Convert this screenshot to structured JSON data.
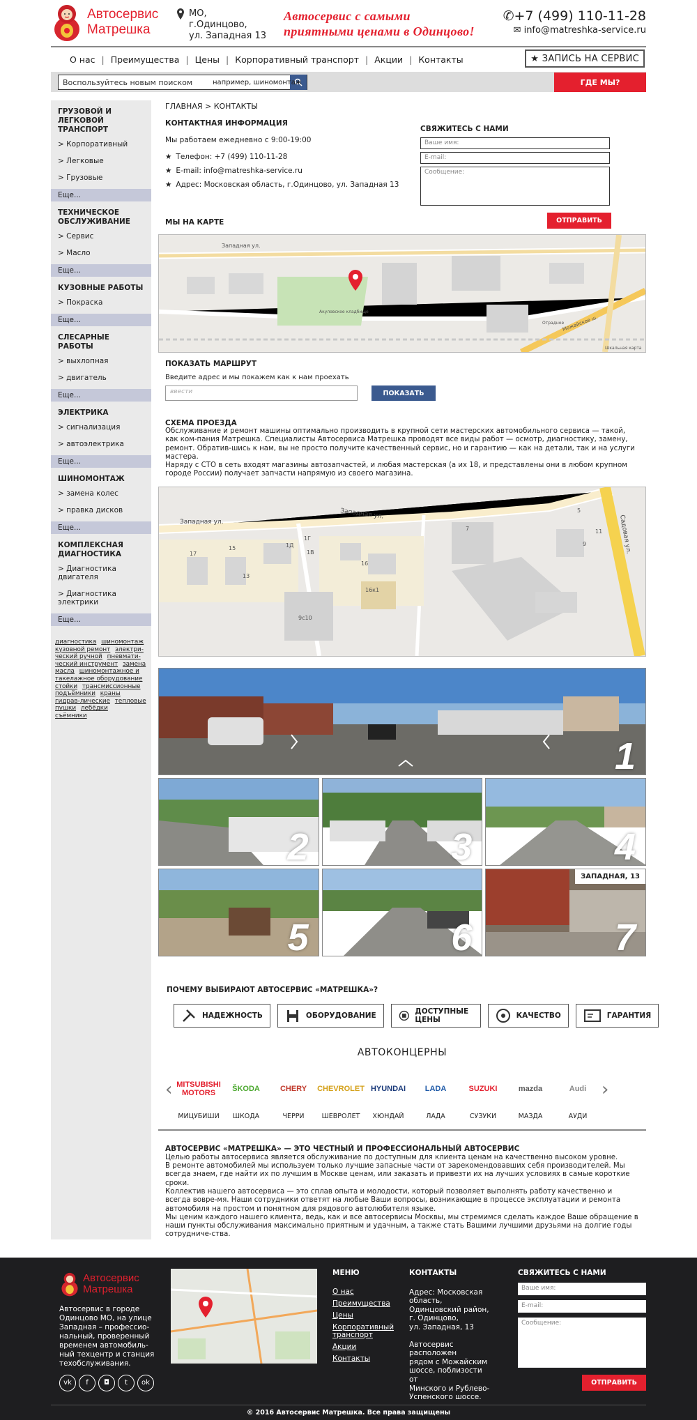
{
  "header": {
    "logo_line1": "Автосервис",
    "logo_line2": "Матрешка",
    "address": [
      "МО,",
      "г.Одинцово,",
      "ул. Западная 13"
    ],
    "slogan_line1": "Автосервис с самыми",
    "slogan_line2": "приятными ценами в Одинцово!",
    "phone": "+7 (499) 110-11-28",
    "email": "info@matreshka-service.ru"
  },
  "nav": [
    "О нас",
    "Преимущества",
    "Цены",
    "Корпоративный транспорт",
    "Акции",
    "Контакты"
  ],
  "appointment_label": "ЗАПИСЬ НА СЕРВИС",
  "search": {
    "value": "Воспользуйтесь новым поиском",
    "hint": "например, шиномонтаж"
  },
  "where_label": "ГДЕ МЫ?",
  "sidebar": [
    {
      "title": "Грузовой и легковой транспорт",
      "items": [
        "> Корпоративный",
        "> Легковые",
        "> Грузовые"
      ]
    },
    {
      "title": "Техническое обслуживание",
      "items": [
        "> Сервис",
        "> Масло"
      ]
    },
    {
      "title": "Кузовные работы",
      "items": [
        "> Покраска"
      ]
    },
    {
      "title": "Слесарные работы",
      "items": [
        "> выхлопная",
        "> двигатель"
      ]
    },
    {
      "title": "Электрика",
      "items": [
        "> сигнализация",
        "> автоэлектрика"
      ]
    },
    {
      "title": "Шиномонтаж",
      "items": [
        "> замена колес",
        "> правка дисков"
      ]
    },
    {
      "title": "Комплексная диагностика",
      "items": [
        "> Диагностика двигателя",
        "> Диагностика электрики"
      ]
    }
  ],
  "more_label": "Еще...",
  "tags": [
    "диагностика",
    "шиномонтаж",
    "кузовной ремонт",
    "электри-ческий ручной",
    "пневмати-ческий инструмент",
    "замена масла",
    "шиномонтажное и такелажное оборудование",
    "стойки",
    "трансмиссионные подъёмники",
    "краны гидрав-лические",
    "тепловые пушки",
    "лебёдки",
    "съёмники"
  ],
  "breadcrumb": "ГЛАВНАЯ > КОНТАКТЫ",
  "contact": {
    "title": "КОНТАКТНАЯ ИНФОРМАЦИЯ",
    "hours": "Мы работаем ежедневно с 9:00-19:00",
    "lines": [
      "Телефон: +7 (499) 110-11-28",
      "E-mail: info@matreshka-service.ru",
      "Адрес: Московская область, г.Одинцово, ул. Западная 13"
    ]
  },
  "form": {
    "title": "СВЯЖИТЕСЬ С НАМИ",
    "name_ph": "Ваше имя:",
    "email_ph": "E-mail:",
    "msg_ph": "Сообщение:",
    "send": "ОТПРАВИТЬ"
  },
  "map_title": "МЫ НА КАРТЕ",
  "map1_labels": {
    "street": "Западная ул.",
    "cemetery": "Акуловское кладбище",
    "highway": "Можайское ш.",
    "station": "Отрадное",
    "footer": "Шкальная карта"
  },
  "route": {
    "title": "ПОКАЗАТЬ МАРШРУТ",
    "hint": "Введите адрес и мы покажем как к нам проехать",
    "input_ph": "ввести",
    "button": "ПОКАЗАТЬ"
  },
  "scheme": {
    "title": "СХЕМА ПРОЕЗДА",
    "text1": "Обслуживание и ремонт машины оптимально производить в крупной сети мастерских автомобильного сервиса — такой, как ком-пания Матрешка. Специалисты Автосервиса Матрешка проводят все виды работ — осмотр, диагностику, замену, ремонт. Обратив-шись к нам, вы не просто получите качественный сервис, но и гарантию — как на детали, так и на услуги мастера.",
    "text2": "Наряду с СТО в сеть входят магазины автозапчастей, и любая мастерская (а их 18, и представлены они в любом крупном городе России) получает запчасти напрямую из своего магазина."
  },
  "map2_labels": {
    "street1": "Западная ул.",
    "street2": "Западная ул.",
    "street3": "Садовая ул.",
    "b1": "17",
    "b2": "15",
    "b3": "13",
    "b4": "1Д",
    "b5": "1Г",
    "b6": "1В",
    "b7": "9с10",
    "b8": "16",
    "b9": "16к1",
    "b10": "7",
    "b11": "9",
    "b12": "11",
    "b13": "5"
  },
  "photos": {
    "n1": "1",
    "n2": "2",
    "n3": "3",
    "n4": "4",
    "n5": "5",
    "n6": "6",
    "n7": "7",
    "tag": "ЗАПАДНАЯ, 13",
    "street": "Западная"
  },
  "why": {
    "title": "ПОЧЕМУ ВЫБИРАЮТ АВТОСЕРВИС «МАТРЕШКА»?",
    "buttons": [
      "НАДЕЖНОСТЬ",
      "ОБОРУДОВАНИЕ",
      "ДОСТУПНЫЕ ЦЕНЫ",
      "КАЧЕСТВО",
      "ГАРАНТИЯ"
    ]
  },
  "brands_title": "АВТОКОНЦЕРНЫ",
  "brands": [
    {
      "name": "МИЦУБИШИ",
      "logo": "MITSUBISHI MOTORS"
    },
    {
      "name": "ШКОДА",
      "logo": "ŠKODA"
    },
    {
      "name": "ЧЕРРИ",
      "logo": "CHERY"
    },
    {
      "name": "ШЕВРОЛЕТ",
      "logo": "CHEVROLET"
    },
    {
      "name": "ХЮНДАЙ",
      "logo": "HYUNDAI"
    },
    {
      "name": "ЛАДА",
      "logo": "LADA"
    },
    {
      "name": "СУЗУКИ",
      "logo": "SUZUKI"
    },
    {
      "name": "МАЗДА",
      "logo": "mazda"
    },
    {
      "name": "АУДИ",
      "logo": "Audi"
    }
  ],
  "about": {
    "title": "АВТОСЕРВИС «МАТРЕШКА» — ЭТО ЧЕСТНЫЙ И ПРОФЕССИОНАЛЬНЫЙ АВТОСЕРВИС",
    "p1": "Целью работы автосервиса является обслуживание по доступным для клиента ценам на качественно высоком уровне.",
    "p2": "В ремонте автомобилей мы используем только лучшие запасные части от зарекомендовавших себя производителей. Мы всегда знаем, где найти их по лучшим в Москве ценам, или заказать и привезти их на лучших условиях в самые короткие сроки.",
    "p3": "Коллектив нашего автосервиса — это сплав опыта и молодости, который позволяет выполнять работу качественно и всегда вовре-мя. Наши сотрудники ответят на любые Ваши вопросы, возникающие в процессе эксплуатации и ремонта автомобиля на простом и понятном для рядового автолюбителя языке.",
    "p4": "Мы ценим каждого нашего клиента, ведь, как и все автосервисы Москвы, мы стремимся сделать каждое Ваше обращение в наши пункты обслуживания максимально приятным и удачным, а также стать Вашими лучшими друзьями на долгие годы сотрудниче-ства."
  },
  "footer": {
    "desc": "Автосервис в городе Одинцово МО, на улице Западная – профессио-нальный, проверенный временем автомобиль-ный техцентр и станция техобслуживания.",
    "menu_title": "МЕНЮ",
    "menu": [
      "О нас",
      "Преимущества",
      "Цены",
      "Корпоративный транспорт",
      "Акции",
      "Контакты"
    ],
    "contacts_title": "КОНТАКТЫ",
    "contacts_addr": [
      "Адрес: Московская",
      "область,",
      "Одинцовский район,",
      "г. Одинцово,",
      "ул. Западная, 13"
    ],
    "contacts_note": [
      "Автосервис расположен",
      "рядом с Можайским",
      "шоссе, поблизости от",
      "Минского и Рублево-",
      "Успенского шоссе."
    ],
    "form_title": "СВЯЖИТЕСЬ С НАМИ",
    "social": [
      "vk",
      "f",
      "ig",
      "tw",
      "ok"
    ],
    "copyright": "© 2016 Автосервис Матрешка. Все права защищены"
  },
  "colors": {
    "accent": "#e4202e",
    "blue": "#3b5a8f",
    "sidebar": "#eaeaea",
    "more": "#c5c8d9",
    "footer": "#1e1e20"
  }
}
